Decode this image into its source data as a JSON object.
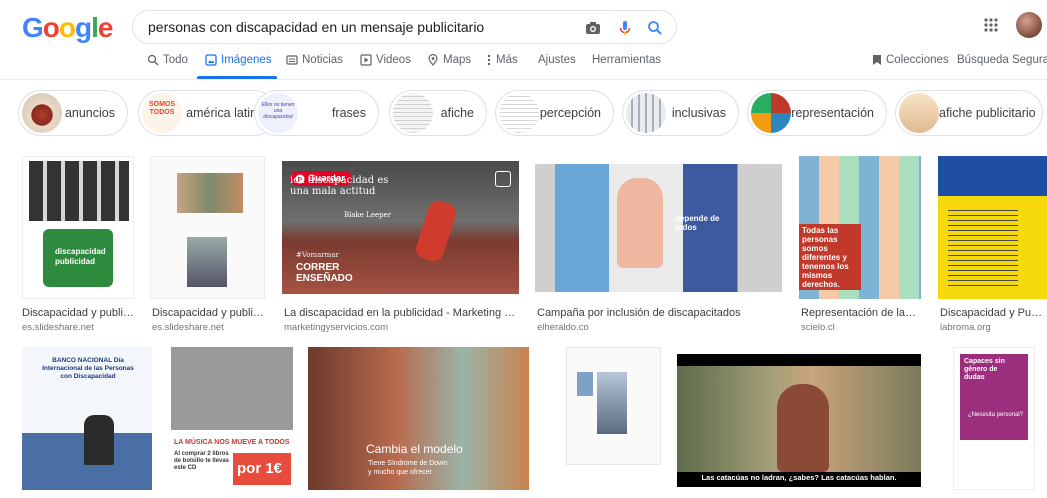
{
  "logo": {
    "letters": [
      "G",
      "o",
      "o",
      "g",
      "l",
      "e"
    ],
    "colors": [
      "#4285f4",
      "#ea4335",
      "#fbbc05",
      "#4285f4",
      "#34a853",
      "#ea4335"
    ]
  },
  "search": {
    "query": "personas con discapacidad en un mensaje publicitario",
    "icons": [
      "camera-icon",
      "microphone-icon",
      "search-icon"
    ]
  },
  "tabs": [
    {
      "label": "Todo",
      "icon": "search-icon"
    },
    {
      "label": "Imágenes",
      "icon": "image-icon",
      "active": true
    },
    {
      "label": "Noticias",
      "icon": "news-icon"
    },
    {
      "label": "Videos",
      "icon": "play-icon"
    },
    {
      "label": "Maps",
      "icon": "map-pin-icon"
    },
    {
      "label": "Más",
      "icon": "more-vertical-icon"
    },
    {
      "label": "Ajustes"
    },
    {
      "label": "Herramientas"
    }
  ],
  "right_tabs": {
    "collections": "Colecciones",
    "safe_search": "Búsqueda Segura"
  },
  "chips": [
    "anuncios",
    "américa latina",
    "frases",
    "afiche",
    "percepción",
    "inclusivas",
    "representación",
    "afiche publicitario"
  ],
  "chip_overlays": {
    "america_latina": "SOMOS TODOS",
    "frases": "Ellos no tienen una discapacidad"
  },
  "results_row1": [
    {
      "caption": "Discapacidad y publici...",
      "source": "es.slideshare.net",
      "overlay": "discapacidad publicidad"
    },
    {
      "caption": "Discapacidad y publicid...",
      "source": "es.slideshare.net"
    },
    {
      "caption": "La discapacidad en la publicidad - Marketing y Serv...",
      "source": "marketingyservicios.com",
      "save_label": "Guardar",
      "overlay_top": "ica discapacidad es una mala actitud",
      "overlay_author": "Blake Leeper",
      "overlay_tag": "#Vomarmar",
      "overlay_bottom": "CORRER ENSEÑADO"
    },
    {
      "caption": "Campaña por inclusión de discapacitados",
      "source": "elheraldo.co",
      "overlay": "depende de todos"
    },
    {
      "caption": "Representación de las pe...",
      "source": "scielo.cl",
      "overlay": "Todas las personas somos diferentes y tenemos los mismos derechos."
    },
    {
      "caption": "Discapacidad y Publici...",
      "source": "labroma.org"
    }
  ],
  "results_row2": [
    {
      "overlay": "BANCO NACIONAL Día Internacional de las Personas con Discapacidad"
    },
    {
      "overlay": "LA MÚSICA NOS MUEVE A TODOS",
      "overlay2": "Al comprar 2 libros de bolsillo te llevas este CD",
      "price": "por 1€"
    },
    {
      "overlay": "Cambia el modelo",
      "overlay2": "Tiene Síndrome de Down y mucho que ofrecer"
    },
    {},
    {
      "subtitle": "Las catacúas no ladran, ¿sabes? Las catacúas hablan."
    },
    {
      "overlay": "Capaces sin género de dudas",
      "overlay2": "¿Necesita personal?"
    }
  ]
}
